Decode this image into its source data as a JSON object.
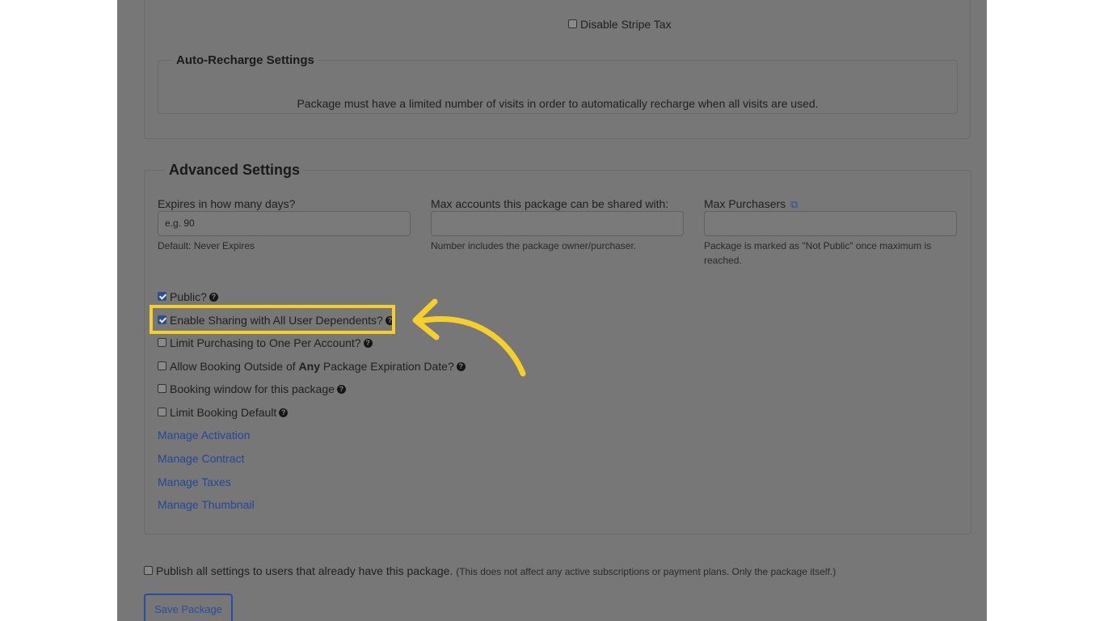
{
  "top_options": {
    "disable_stripe_tax": {
      "label": "Disable Stripe Tax",
      "checked": false
    }
  },
  "auto_recharge": {
    "title": "Auto-Recharge Settings",
    "description": "Package must have a limited number of visits in order to automatically recharge when all visits are used."
  },
  "advanced": {
    "title": "Advanced Settings",
    "fields": {
      "expires": {
        "label": "Expires in how many days?",
        "placeholder": "e.g. 90",
        "help": "Default: Never Expires"
      },
      "max_accounts": {
        "label": "Max accounts this package can be shared with:",
        "placeholder": "",
        "help": "Number includes the package owner/purchaser."
      },
      "max_purchasers": {
        "label": "Max Purchasers",
        "icon": "external-link-icon",
        "placeholder": "",
        "help": "Package is marked as \"Not Public\" once maximum is reached."
      }
    },
    "options": [
      {
        "label": "Public?",
        "checked": true
      },
      {
        "label": "Enable Sharing with All User Dependents?",
        "checked": true
      },
      {
        "label": "Limit Purchasing to One Per Account?",
        "checked": false
      },
      {
        "label_before": "Allow Booking Outside of ",
        "label_bold": "Any",
        "label_after": " Package Expiration Date?",
        "checked": false
      },
      {
        "label": "Booking window for this package",
        "checked": false
      },
      {
        "label": "Limit Booking Default",
        "checked": false
      }
    ],
    "links": [
      "Manage Activation",
      "Manage Contract",
      "Manage Taxes",
      "Manage Thumbnail"
    ]
  },
  "publish": {
    "label": "Publish all settings to users that already have this package.",
    "note": "(This does not affect any active subscriptions or payment plans. Only the package itself.)",
    "checked": false
  },
  "save_button": "Save Package",
  "help_icon_glyph": "?",
  "external_link_glyph": "⧉",
  "colors": {
    "highlight": "#f5cf2c",
    "link": "#23479a",
    "overlay": "#777777"
  }
}
